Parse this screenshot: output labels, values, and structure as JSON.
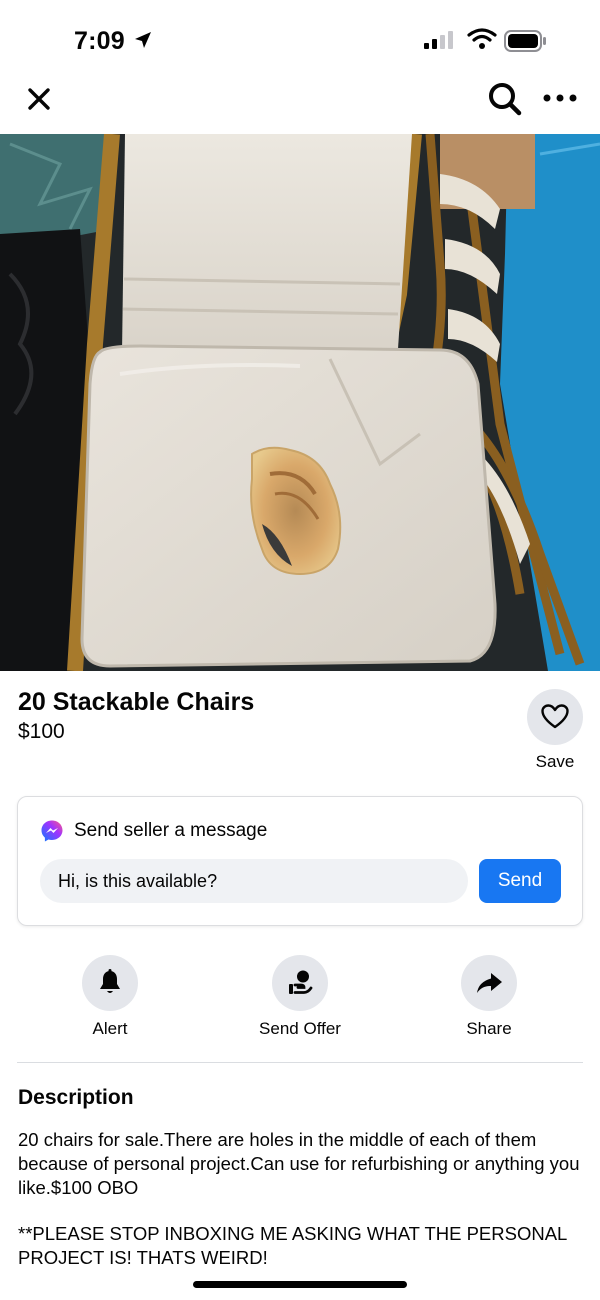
{
  "status_bar": {
    "time": "7:09",
    "icons": [
      "location-arrow-icon",
      "cellular-signal-icon",
      "wifi-icon",
      "battery-icon"
    ]
  },
  "nav": {
    "icons": [
      "close-icon",
      "search-icon",
      "more-icon"
    ]
  },
  "photo": {
    "subject": "chair-listing-photo"
  },
  "listing": {
    "title": "20 Stackable Chairs",
    "price": "$100",
    "save_label": "Save"
  },
  "message": {
    "heading": "Send seller a message",
    "input_value": "Hi, is this available?",
    "send_label": "Send"
  },
  "actions": [
    {
      "label": "Alert",
      "icon": "bell-icon"
    },
    {
      "label": "Send Offer",
      "icon": "offer-icon"
    },
    {
      "label": "Share",
      "icon": "share-arrow-icon"
    }
  ],
  "description": {
    "heading": "Description",
    "body": "20 chairs for sale.There are holes in the middle of each of them because of personal project.Can use for refurbishing or anything you like.$100 OBO",
    "warning": "**PLEASE STOP INBOXING ME ASKING WHAT THE PERSONAL PROJECT IS! THATS WEIRD!"
  },
  "colors": {
    "accent": "#1877f2",
    "button_bg": "#e4e6eb",
    "input_bg": "#f0f2f5",
    "text": "#050505"
  }
}
